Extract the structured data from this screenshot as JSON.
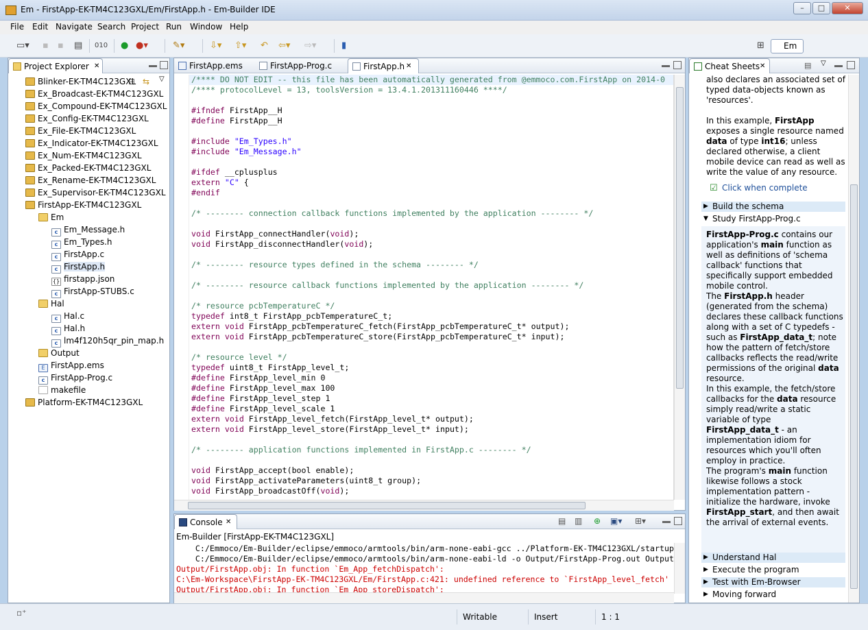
{
  "window": {
    "title": "Em - FirstApp-EK-TM4C123GXL/Em/FirstApp.h - Em-Builder IDE",
    "min": "–",
    "max": "□",
    "close": "✕"
  },
  "menu": [
    "File",
    "Edit",
    "Navigate",
    "Search",
    "Project",
    "Run",
    "Window",
    "Help"
  ],
  "perspective": {
    "label": "Em"
  },
  "project_explorer": {
    "title": "Project Explorer",
    "items": [
      {
        "label": "Blinker-EK-TM4C123GXL",
        "type": "proj",
        "indent": 0
      },
      {
        "label": "Ex_Broadcast-EK-TM4C123GXL",
        "type": "proj",
        "indent": 0
      },
      {
        "label": "Ex_Compound-EK-TM4C123GXL",
        "type": "proj",
        "indent": 0
      },
      {
        "label": "Ex_Config-EK-TM4C123GXL",
        "type": "proj",
        "indent": 0
      },
      {
        "label": "Ex_File-EK-TM4C123GXL",
        "type": "proj",
        "indent": 0
      },
      {
        "label": "Ex_Indicator-EK-TM4C123GXL",
        "type": "proj",
        "indent": 0
      },
      {
        "label": "Ex_Num-EK-TM4C123GXL",
        "type": "proj",
        "indent": 0
      },
      {
        "label": "Ex_Packed-EK-TM4C123GXL",
        "type": "proj",
        "indent": 0
      },
      {
        "label": "Ex_Rename-EK-TM4C123GXL",
        "type": "proj",
        "indent": 0
      },
      {
        "label": "Ex_Supervisor-EK-TM4C123GXL",
        "type": "proj",
        "indent": 0
      },
      {
        "label": "FirstApp-EK-TM4C123GXL",
        "type": "proj",
        "indent": 0
      },
      {
        "label": "Em",
        "type": "fold",
        "indent": 1
      },
      {
        "label": "Em_Message.h",
        "type": "cfile",
        "indent": 2
      },
      {
        "label": "Em_Types.h",
        "type": "cfile",
        "indent": 2
      },
      {
        "label": "FirstApp.c",
        "type": "cfile",
        "indent": 2
      },
      {
        "label": "FirstApp.h",
        "type": "cfile",
        "indent": 2,
        "selected": true
      },
      {
        "label": "firstapp.json",
        "type": "jfile",
        "indent": 2
      },
      {
        "label": "FirstApp-STUBS.c",
        "type": "cfile",
        "indent": 2
      },
      {
        "label": "Hal",
        "type": "fold",
        "indent": 1
      },
      {
        "label": "Hal.c",
        "type": "cfile",
        "indent": 2
      },
      {
        "label": "Hal.h",
        "type": "cfile",
        "indent": 2
      },
      {
        "label": "lm4f120h5qr_pin_map.h",
        "type": "cfile",
        "indent": 2
      },
      {
        "label": "Output",
        "type": "fold",
        "indent": 1
      },
      {
        "label": "FirstApp.ems",
        "type": "efile",
        "indent": 1
      },
      {
        "label": "FirstApp-Prog.c",
        "type": "cfile",
        "indent": 1
      },
      {
        "label": "makefile",
        "type": "mfile",
        "indent": 1
      },
      {
        "label": "Platform-EK-TM4C123GXL",
        "type": "proj",
        "indent": 0
      }
    ]
  },
  "editor": {
    "tabs": [
      {
        "label": "FirstApp.ems"
      },
      {
        "label": "FirstApp-Prog.c"
      },
      {
        "label": "FirstApp.h",
        "active": true
      }
    ],
    "lines": [
      [
        [
          "cm",
          "/**** DO NOT EDIT -- this file has been automatically generated from @emmoco.com.FirstApp on 2014-0"
        ]
      ],
      [
        [
          "cm",
          "/**** protocolLevel = 13, toolsVersion = 13.4.1.201311160446 ****/"
        ]
      ],
      [],
      [
        [
          "pp",
          "#ifndef"
        ],
        [
          "tx",
          " FirstApp__H"
        ]
      ],
      [
        [
          "pp",
          "#define"
        ],
        [
          "tx",
          " FirstApp__H"
        ]
      ],
      [],
      [
        [
          "pp",
          "#include"
        ],
        [
          "tx",
          " "
        ],
        [
          "st",
          "\"Em_Types.h\""
        ]
      ],
      [
        [
          "pp",
          "#include"
        ],
        [
          "tx",
          " "
        ],
        [
          "st",
          "\"Em_Message.h\""
        ]
      ],
      [],
      [
        [
          "pp",
          "#ifdef"
        ],
        [
          "tx",
          " __cplusplus"
        ]
      ],
      [
        [
          "kw",
          "extern"
        ],
        [
          "tx",
          " "
        ],
        [
          "st",
          "\"C\""
        ],
        [
          "tx",
          " {"
        ]
      ],
      [
        [
          "pp",
          "#endif"
        ]
      ],
      [],
      [
        [
          "cm",
          "/* -------- connection callback functions implemented by the application -------- */"
        ]
      ],
      [],
      [
        [
          "kw",
          "void"
        ],
        [
          "tx",
          " FirstApp_connectHandler("
        ],
        [
          "kw",
          "void"
        ],
        [
          "tx",
          ");"
        ]
      ],
      [
        [
          "kw",
          "void"
        ],
        [
          "tx",
          " FirstApp_disconnectHandler("
        ],
        [
          "kw",
          "void"
        ],
        [
          "tx",
          ");"
        ]
      ],
      [],
      [
        [
          "cm",
          "/* -------- resource types defined in the schema -------- */"
        ]
      ],
      [],
      [
        [
          "cm",
          "/* -------- resource callback functions implemented by the application -------- */"
        ]
      ],
      [],
      [
        [
          "cm",
          "/* resource pcbTemperatureC */"
        ]
      ],
      [
        [
          "kw",
          "typedef"
        ],
        [
          "tx",
          " int8_t FirstApp_pcbTemperatureC_t;"
        ]
      ],
      [
        [
          "kw",
          "extern"
        ],
        [
          "tx",
          " "
        ],
        [
          "kw",
          "void"
        ],
        [
          "tx",
          " FirstApp_pcbTemperatureC_fetch(FirstApp_pcbTemperatureC_t* output);"
        ]
      ],
      [
        [
          "kw",
          "extern"
        ],
        [
          "tx",
          " "
        ],
        [
          "kw",
          "void"
        ],
        [
          "tx",
          " FirstApp_pcbTemperatureC_store(FirstApp_pcbTemperatureC_t* input);"
        ]
      ],
      [],
      [
        [
          "cm",
          "/* resource level */"
        ]
      ],
      [
        [
          "kw",
          "typedef"
        ],
        [
          "tx",
          " uint8_t FirstApp_level_t;"
        ]
      ],
      [
        [
          "pp",
          "#define"
        ],
        [
          "tx",
          " FirstApp_level_min 0"
        ]
      ],
      [
        [
          "pp",
          "#define"
        ],
        [
          "tx",
          " FirstApp_level_max 100"
        ]
      ],
      [
        [
          "pp",
          "#define"
        ],
        [
          "tx",
          " FirstApp_level_step 1"
        ]
      ],
      [
        [
          "pp",
          "#define"
        ],
        [
          "tx",
          " FirstApp_level_scale 1"
        ]
      ],
      [
        [
          "kw",
          "extern"
        ],
        [
          "tx",
          " "
        ],
        [
          "kw",
          "void"
        ],
        [
          "tx",
          " FirstApp_level_fetch(FirstApp_level_t* output);"
        ]
      ],
      [
        [
          "kw",
          "extern"
        ],
        [
          "tx",
          " "
        ],
        [
          "kw",
          "void"
        ],
        [
          "tx",
          " FirstApp_level_store(FirstApp_level_t* input);"
        ]
      ],
      [],
      [
        [
          "cm",
          "/* -------- application functions implemented in FirstApp.c -------- */"
        ]
      ],
      [],
      [
        [
          "kw",
          "void"
        ],
        [
          "tx",
          " FirstApp_accept(bool enable);"
        ]
      ],
      [
        [
          "kw",
          "void"
        ],
        [
          "tx",
          " FirstApp_activateParameters(uint8_t group);"
        ]
      ],
      [
        [
          "kw",
          "void"
        ],
        [
          "tx",
          " FirstApp_broadcastOff("
        ],
        [
          "kw",
          "void"
        ],
        [
          "tx",
          ");"
        ]
      ]
    ]
  },
  "console": {
    "tab": "Console",
    "title": "Em-Builder [FirstApp-EK-TM4C123GXL]",
    "lines": [
      {
        "c": "g",
        "t": "    C:/Emmoco/Em-Builder/eclipse/emmoco/armtools/bin/arm-none-eabi-gcc ../Platform-EK-TM4C123GXL/startup"
      },
      {
        "c": "g",
        "t": "    C:/Emmoco/Em-Builder/eclipse/emmoco/armtools/bin/arm-none-eabi-ld -o Output/FirstApp-Prog.out Output"
      },
      {
        "c": "r",
        "t": "Output/FirstApp.obj: In function `Em_App_fetchDispatch':"
      },
      {
        "c": "r",
        "t": "C:\\Em-Workspace\\FirstApp-EK-TM4C123GXL/Em/FirstApp.c:421: undefined reference to `FirstApp_level_fetch'"
      },
      {
        "c": "r",
        "t": "Output/FirstApp.obj: In function `Em_App_storeDispatch':"
      }
    ]
  },
  "cheat_sheets": {
    "title": "Cheat Sheets",
    "intro_html": "also declares an associated set of typed data-objects known as 'resources'.",
    "p1": [
      "In this example, ",
      "FirstApp",
      " exposes a single resource named ",
      "data",
      " of type ",
      "int16",
      "; unless declared otherwise, a client mobile device can read as well as write the value of any resource."
    ],
    "click_when_complete": "Click when complete",
    "sections": [
      {
        "label": "Build the schema",
        "expanded": false
      },
      {
        "label": "Study FirstApp-Prog.c",
        "expanded": true
      },
      {
        "label": "Understand Hal",
        "expanded": false
      },
      {
        "label": "Execute the program",
        "expanded": false
      },
      {
        "label": "Test with Em-Browser",
        "expanded": false
      },
      {
        "label": "Moving forward",
        "expanded": false
      }
    ],
    "p2": [
      "FirstApp-Prog.c",
      " contains our application's ",
      "main",
      " function as well as definitions of 'schema callback' functions that specifically support embedded mobile control."
    ],
    "p3": [
      "The ",
      "FirstApp.h",
      " header (generated from the schema) declares these callback functions along with a set of C typedefs - such as ",
      "FirstApp_data_t",
      "; note how the pattern of fetch/store callbacks reflects the read/write permissions of the original ",
      "data",
      " resource."
    ],
    "p4": [
      "In this example, the fetch/store callbacks for the ",
      "data",
      " resource simply read/write a static variable of type ",
      "FirstApp_data_t",
      " - an implementation idiom for resources which you'll often employ in practice."
    ],
    "p5": [
      "The program's ",
      "main",
      " function likewise follows a stock implementation pattern - initialize the hardware, invoke ",
      "FirstApp_start",
      ", and then await the arrival of external events."
    ]
  },
  "status": {
    "writable": "Writable",
    "insert": "Insert",
    "position": "1 : 1"
  }
}
